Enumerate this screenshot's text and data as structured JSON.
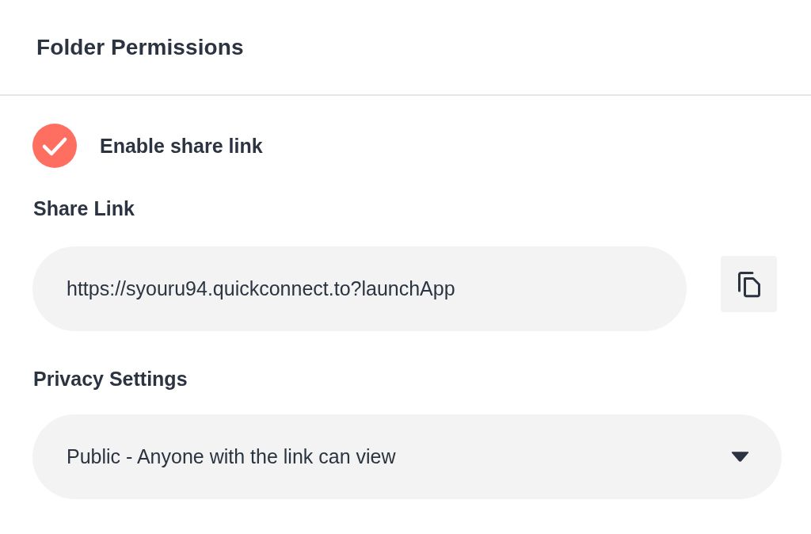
{
  "header": {
    "title": "Folder Permissions"
  },
  "share_toggle": {
    "label": "Enable share link",
    "checked": true
  },
  "share_link": {
    "label": "Share Link",
    "value": "https://syouru94.quickconnect.to?launchApp"
  },
  "privacy": {
    "label": "Privacy Settings",
    "value": "Public - Anyone with the link can view"
  }
}
